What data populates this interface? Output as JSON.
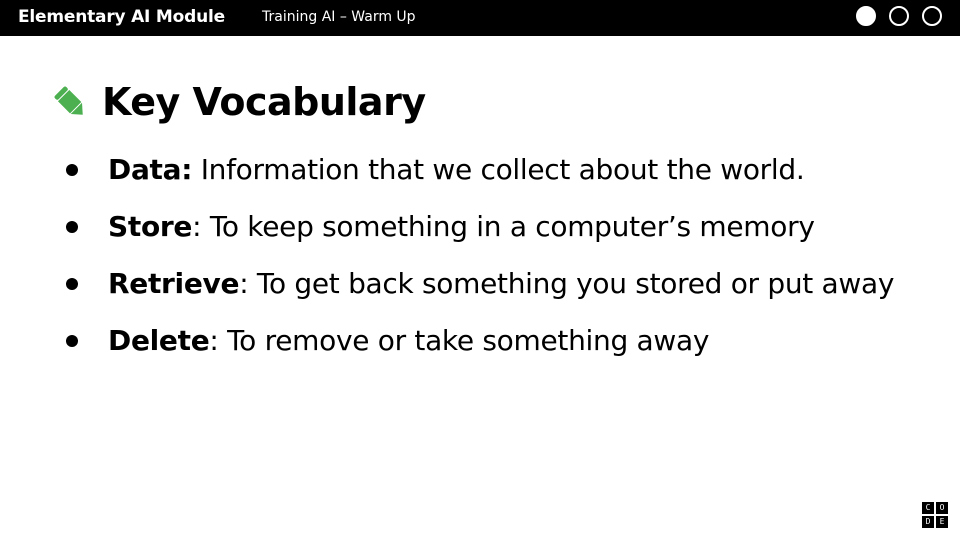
{
  "header": {
    "module_title": "Elementary AI Module",
    "lesson_title": "Training AI – Warm Up",
    "progress_total": 3,
    "progress_current": 1
  },
  "slide": {
    "heading_icon": "pencil-icon",
    "heading": "Key Vocabulary",
    "items": [
      {
        "term": "Data:",
        "definition": " Information that we collect about the world."
      },
      {
        "term": "Store",
        "definition": ": To keep something in a computer’s memory"
      },
      {
        "term": "Retrieve",
        "definition": ": To get back something you stored or put away"
      },
      {
        "term": "Delete",
        "definition": ": To remove or take something away"
      }
    ]
  },
  "logo": {
    "letters": [
      "C",
      "O",
      "D",
      "E"
    ]
  },
  "colors": {
    "topbar": "#000000",
    "pencil_green": "#4CAF50",
    "text": "#000000"
  }
}
